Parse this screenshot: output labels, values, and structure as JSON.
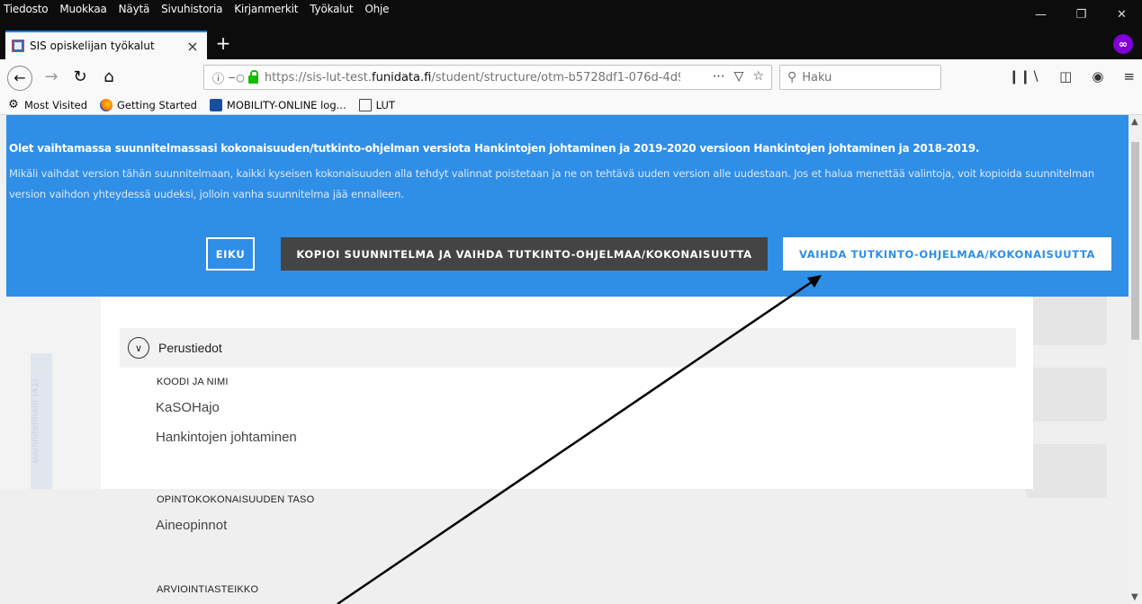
{
  "menubar": {
    "items": [
      "Tiedosto",
      "Muokkaa",
      "Näytä",
      "Sivuhistoria",
      "Kirjanmerkit",
      "Työkalut",
      "Ohje"
    ]
  },
  "tab": {
    "title": "SIS opiskelijan työkalut"
  },
  "url": {
    "prefix": "https://sis-lut-test.",
    "domain": "funidata.fi",
    "path": "/student/structure/otm-b5728df1-076d-4d9"
  },
  "search": {
    "placeholder": "Haku"
  },
  "bookmarks": [
    "Most Visited",
    "Getting Started",
    "MOBILITY-ONLINE log...",
    "LUT"
  ],
  "banner": {
    "headline": "Olet vaihtamassa suunnitelmassasi kokonaisuuden/tutkinto-ohjelman versiota Hankintojen johtaminen ja 2019-2020 versioon Hankintojen johtaminen ja 2018-2019.",
    "body": "Mikäli vaihdat version tähän suunnitelmaan, kaikki kyseisen kokonaisuuden alla tehdyt valinnat poistetaan ja ne on tehtävä uuden version alle uudestaan. Jos et halua menettää valintoja, voit kopioida suunnitelman version vaihdon yhteydessä uudeksi, jolloin vanha suunnitelma jää ennalleen.",
    "btn_cancel": "EIKU",
    "btn_copy": "KOPIOI SUUNNITELMA JA VAIHDA TUTKINTO-OHJELMAA/KOKONAISUUTTA",
    "btn_switch": "VAIHDA TUTKINTO-OHJELMAA/KOKONAISUUTTA"
  },
  "section": {
    "title": "Perustiedot"
  },
  "fields": {
    "code_name_label": "KOODI JA NIMI",
    "code": "KaSOHajo",
    "name": "Hankintojen johtaminen",
    "level_label": "OPINTOKOKONAISUUDEN TASO",
    "level": "Aineopinnot",
    "grading_label": "ARVIOINTIASTEIKKO"
  },
  "side_tab": {
    "label": "suunnitelmani (41)"
  },
  "colors": {
    "banner_blue": "#2f8ee6",
    "dark_button": "#444444"
  }
}
